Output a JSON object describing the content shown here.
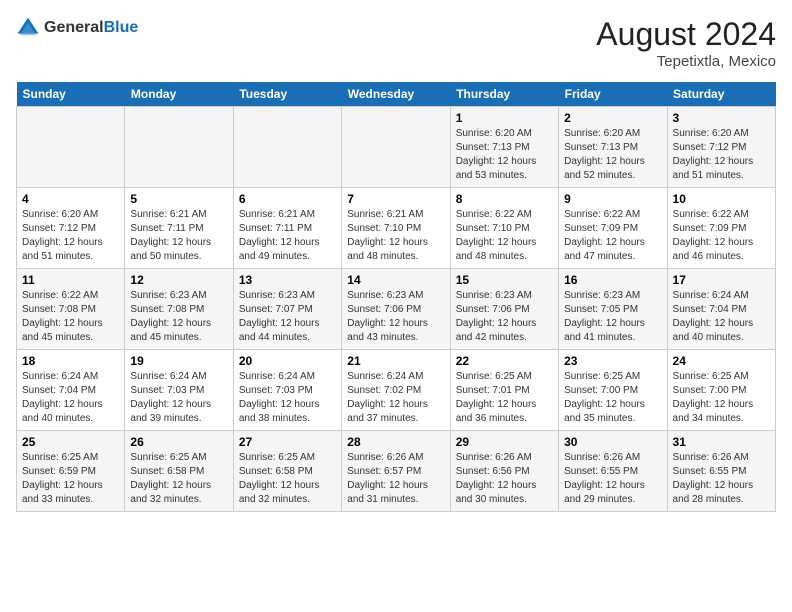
{
  "header": {
    "logo_general": "General",
    "logo_blue": "Blue",
    "month_year": "August 2024",
    "location": "Tepetixtla, Mexico"
  },
  "days_of_week": [
    "Sunday",
    "Monday",
    "Tuesday",
    "Wednesday",
    "Thursday",
    "Friday",
    "Saturday"
  ],
  "weeks": [
    [
      {
        "day": "",
        "info": ""
      },
      {
        "day": "",
        "info": ""
      },
      {
        "day": "",
        "info": ""
      },
      {
        "day": "",
        "info": ""
      },
      {
        "day": "1",
        "sunrise": "Sunrise: 6:20 AM",
        "sunset": "Sunset: 7:13 PM",
        "daylight": "Daylight: 12 hours and 53 minutes."
      },
      {
        "day": "2",
        "sunrise": "Sunrise: 6:20 AM",
        "sunset": "Sunset: 7:13 PM",
        "daylight": "Daylight: 12 hours and 52 minutes."
      },
      {
        "day": "3",
        "sunrise": "Sunrise: 6:20 AM",
        "sunset": "Sunset: 7:12 PM",
        "daylight": "Daylight: 12 hours and 51 minutes."
      }
    ],
    [
      {
        "day": "4",
        "sunrise": "Sunrise: 6:20 AM",
        "sunset": "Sunset: 7:12 PM",
        "daylight": "Daylight: 12 hours and 51 minutes."
      },
      {
        "day": "5",
        "sunrise": "Sunrise: 6:21 AM",
        "sunset": "Sunset: 7:11 PM",
        "daylight": "Daylight: 12 hours and 50 minutes."
      },
      {
        "day": "6",
        "sunrise": "Sunrise: 6:21 AM",
        "sunset": "Sunset: 7:11 PM",
        "daylight": "Daylight: 12 hours and 49 minutes."
      },
      {
        "day": "7",
        "sunrise": "Sunrise: 6:21 AM",
        "sunset": "Sunset: 7:10 PM",
        "daylight": "Daylight: 12 hours and 48 minutes."
      },
      {
        "day": "8",
        "sunrise": "Sunrise: 6:22 AM",
        "sunset": "Sunset: 7:10 PM",
        "daylight": "Daylight: 12 hours and 48 minutes."
      },
      {
        "day": "9",
        "sunrise": "Sunrise: 6:22 AM",
        "sunset": "Sunset: 7:09 PM",
        "daylight": "Daylight: 12 hours and 47 minutes."
      },
      {
        "day": "10",
        "sunrise": "Sunrise: 6:22 AM",
        "sunset": "Sunset: 7:09 PM",
        "daylight": "Daylight: 12 hours and 46 minutes."
      }
    ],
    [
      {
        "day": "11",
        "sunrise": "Sunrise: 6:22 AM",
        "sunset": "Sunset: 7:08 PM",
        "daylight": "Daylight: 12 hours and 45 minutes."
      },
      {
        "day": "12",
        "sunrise": "Sunrise: 6:23 AM",
        "sunset": "Sunset: 7:08 PM",
        "daylight": "Daylight: 12 hours and 45 minutes."
      },
      {
        "day": "13",
        "sunrise": "Sunrise: 6:23 AM",
        "sunset": "Sunset: 7:07 PM",
        "daylight": "Daylight: 12 hours and 44 minutes."
      },
      {
        "day": "14",
        "sunrise": "Sunrise: 6:23 AM",
        "sunset": "Sunset: 7:06 PM",
        "daylight": "Daylight: 12 hours and 43 minutes."
      },
      {
        "day": "15",
        "sunrise": "Sunrise: 6:23 AM",
        "sunset": "Sunset: 7:06 PM",
        "daylight": "Daylight: 12 hours and 42 minutes."
      },
      {
        "day": "16",
        "sunrise": "Sunrise: 6:23 AM",
        "sunset": "Sunset: 7:05 PM",
        "daylight": "Daylight: 12 hours and 41 minutes."
      },
      {
        "day": "17",
        "sunrise": "Sunrise: 6:24 AM",
        "sunset": "Sunset: 7:04 PM",
        "daylight": "Daylight: 12 hours and 40 minutes."
      }
    ],
    [
      {
        "day": "18",
        "sunrise": "Sunrise: 6:24 AM",
        "sunset": "Sunset: 7:04 PM",
        "daylight": "Daylight: 12 hours and 40 minutes."
      },
      {
        "day": "19",
        "sunrise": "Sunrise: 6:24 AM",
        "sunset": "Sunset: 7:03 PM",
        "daylight": "Daylight: 12 hours and 39 minutes."
      },
      {
        "day": "20",
        "sunrise": "Sunrise: 6:24 AM",
        "sunset": "Sunset: 7:03 PM",
        "daylight": "Daylight: 12 hours and 38 minutes."
      },
      {
        "day": "21",
        "sunrise": "Sunrise: 6:24 AM",
        "sunset": "Sunset: 7:02 PM",
        "daylight": "Daylight: 12 hours and 37 minutes."
      },
      {
        "day": "22",
        "sunrise": "Sunrise: 6:25 AM",
        "sunset": "Sunset: 7:01 PM",
        "daylight": "Daylight: 12 hours and 36 minutes."
      },
      {
        "day": "23",
        "sunrise": "Sunrise: 6:25 AM",
        "sunset": "Sunset: 7:00 PM",
        "daylight": "Daylight: 12 hours and 35 minutes."
      },
      {
        "day": "24",
        "sunrise": "Sunrise: 6:25 AM",
        "sunset": "Sunset: 7:00 PM",
        "daylight": "Daylight: 12 hours and 34 minutes."
      }
    ],
    [
      {
        "day": "25",
        "sunrise": "Sunrise: 6:25 AM",
        "sunset": "Sunset: 6:59 PM",
        "daylight": "Daylight: 12 hours and 33 minutes."
      },
      {
        "day": "26",
        "sunrise": "Sunrise: 6:25 AM",
        "sunset": "Sunset: 6:58 PM",
        "daylight": "Daylight: 12 hours and 32 minutes."
      },
      {
        "day": "27",
        "sunrise": "Sunrise: 6:25 AM",
        "sunset": "Sunset: 6:58 PM",
        "daylight": "Daylight: 12 hours and 32 minutes."
      },
      {
        "day": "28",
        "sunrise": "Sunrise: 6:26 AM",
        "sunset": "Sunset: 6:57 PM",
        "daylight": "Daylight: 12 hours and 31 minutes."
      },
      {
        "day": "29",
        "sunrise": "Sunrise: 6:26 AM",
        "sunset": "Sunset: 6:56 PM",
        "daylight": "Daylight: 12 hours and 30 minutes."
      },
      {
        "day": "30",
        "sunrise": "Sunrise: 6:26 AM",
        "sunset": "Sunset: 6:55 PM",
        "daylight": "Daylight: 12 hours and 29 minutes."
      },
      {
        "day": "31",
        "sunrise": "Sunrise: 6:26 AM",
        "sunset": "Sunset: 6:55 PM",
        "daylight": "Daylight: 12 hours and 28 minutes."
      }
    ]
  ]
}
